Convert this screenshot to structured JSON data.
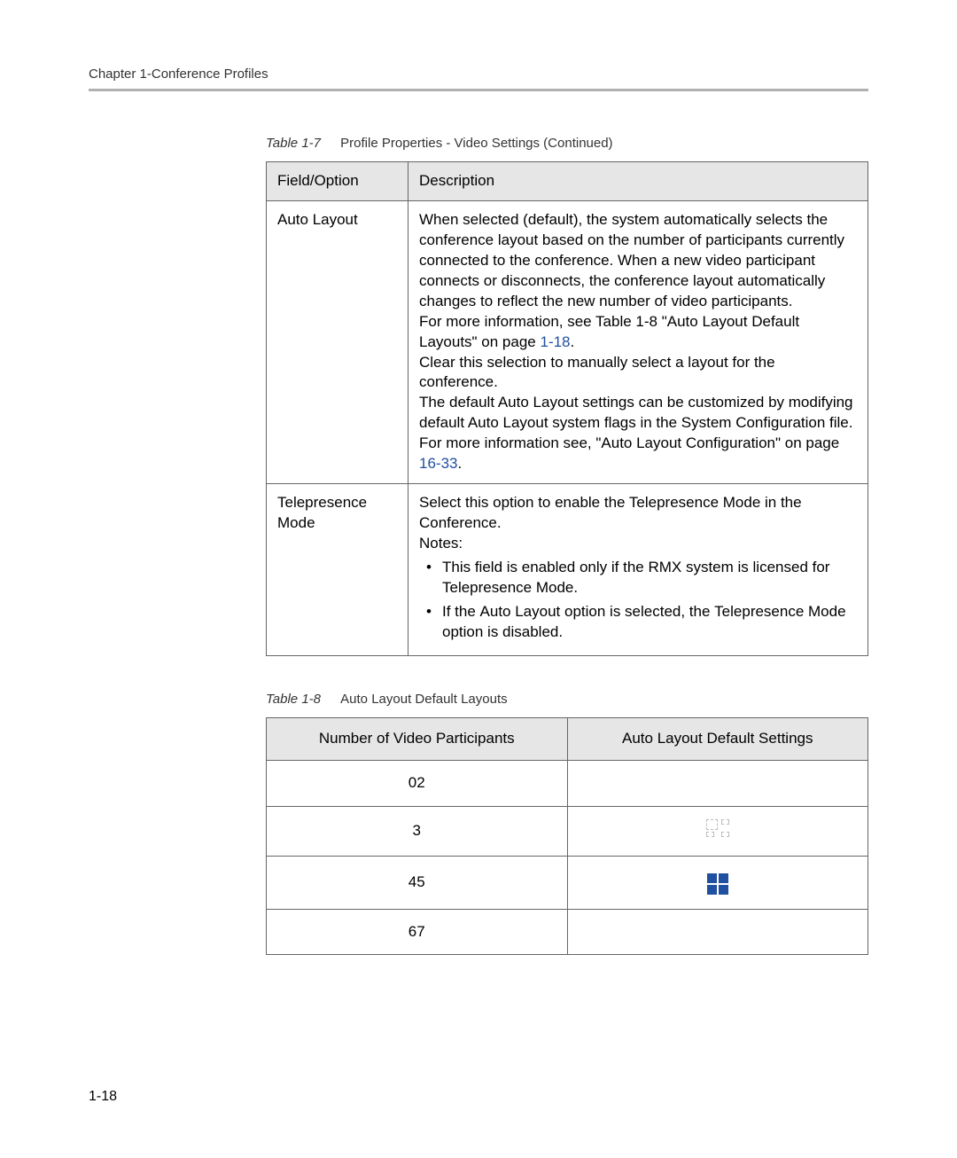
{
  "header": {
    "chapter": "Chapter 1-Conference Profiles"
  },
  "table1": {
    "caption_label": "Table 1-7",
    "caption_title": "Profile Properties - Video Settings (Continued)",
    "headers": {
      "field": "Field/Option",
      "description": "Description"
    },
    "row1": {
      "field": "Auto Layout",
      "desc_p1": "When selected (default), the system automatically selects the conference layout based on the number of participants currently connected to the conference. When a new video participant connects or disconnects, the conference layout automatically changes to reflect the new number of video participants.",
      "desc_p2a": "For more information, see Table 1-8 \"",
      "desc_p2b": "Auto Layout Default Layouts\"",
      "desc_p2c": " on page ",
      "desc_p2d": "1-18",
      "desc_p2e": ".",
      "desc_p3": "Clear this selection to manually select a layout for the conference.",
      "desc_p4a": "The default Auto Layout settings can be customized by modifying default Auto Layout system flags in the System Configuration file. For more information see, ",
      "desc_p4b": "\"Auto Layout Configuration\"",
      "desc_p4c": " on page ",
      "desc_p4d": "16-33",
      "desc_p4e": "."
    },
    "row2": {
      "field": "Telepresence Mode",
      "desc_p1": "Select this option to enable the Telepresence Mode in the Conference.",
      "desc_notes_label": "Notes:",
      "bullet1": "This field is enabled only if the RMX system is licensed for Telepresence Mode.",
      "bullet2a": "If the ",
      "bullet2b": "Auto Layout",
      "bullet2c": " option is selected, the ",
      "bullet2d": "Telepresence Mode",
      "bullet2e": " option is disabled."
    }
  },
  "table2": {
    "caption_label": "Table 1-8",
    "caption_title": "Auto Layout Default Layouts",
    "headers": {
      "col1": "Number of Video Participants",
      "col2": "Auto Layout Default Settings"
    },
    "rows": {
      "r1": "02",
      "r2": "3",
      "r3": "45",
      "r4": "67"
    }
  },
  "page_number": "1-18"
}
